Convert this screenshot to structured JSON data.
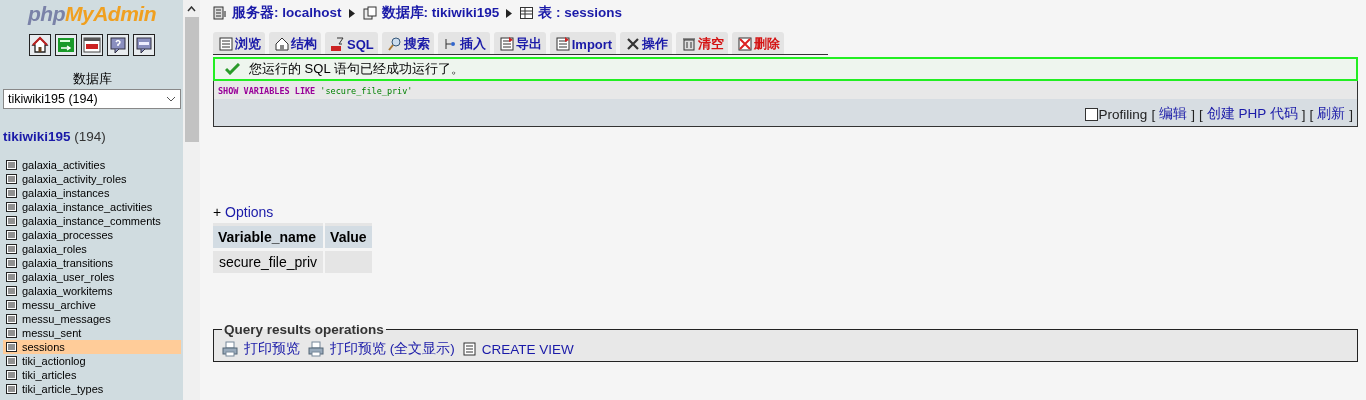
{
  "sidebar": {
    "logo": {
      "php": "php",
      "rest": "MyAdmin"
    },
    "icon_buttons": [
      {
        "kind": "home"
      },
      {
        "kind": "exit"
      },
      {
        "kind": "sql"
      },
      {
        "kind": "help"
      },
      {
        "kind": "docs"
      }
    ],
    "database_label": "数据库",
    "database_select": {
      "value": "tikiwiki195 (194)"
    },
    "db_title": {
      "name": "tikiwiki195",
      "count": "(194)"
    },
    "tables": [
      {
        "name": "galaxia_activities",
        "selected": false
      },
      {
        "name": "galaxia_activity_roles",
        "selected": false
      },
      {
        "name": "galaxia_instances",
        "selected": false
      },
      {
        "name": "galaxia_instance_activities",
        "selected": false
      },
      {
        "name": "galaxia_instance_comments",
        "selected": false
      },
      {
        "name": "galaxia_processes",
        "selected": false
      },
      {
        "name": "galaxia_roles",
        "selected": false
      },
      {
        "name": "galaxia_transitions",
        "selected": false
      },
      {
        "name": "galaxia_user_roles",
        "selected": false
      },
      {
        "name": "galaxia_workitems",
        "selected": false
      },
      {
        "name": "messu_archive",
        "selected": false
      },
      {
        "name": "messu_messages",
        "selected": false
      },
      {
        "name": "messu_sent",
        "selected": false
      },
      {
        "name": "sessions",
        "selected": true
      },
      {
        "name": "tiki_actionlog",
        "selected": false
      },
      {
        "name": "tiki_articles",
        "selected": false
      },
      {
        "name": "tiki_article_types",
        "selected": false
      }
    ]
  },
  "breadcrumb": [
    {
      "kind": "server",
      "label": "服务器: localhost"
    },
    {
      "kind": "database",
      "label": "数据库: tikiwiki195"
    },
    {
      "kind": "table",
      "label": "表 : sessions"
    }
  ],
  "tabs": [
    {
      "label": "浏览",
      "kind": "browse"
    },
    {
      "label": "结构",
      "kind": "structure"
    },
    {
      "label": "SQL",
      "kind": "sql"
    },
    {
      "label": "搜索",
      "kind": "search"
    },
    {
      "label": "插入",
      "kind": "insert"
    },
    {
      "label": "导出",
      "kind": "export"
    },
    {
      "label": "Import",
      "kind": "import"
    },
    {
      "label": "操作",
      "kind": "operations"
    },
    {
      "label": "清空",
      "kind": "empty"
    },
    {
      "label": "删除",
      "kind": "drop"
    }
  ],
  "success_message": "您运行的 SQL 语句已经成功运行了。",
  "query": {
    "keywords": "SHOW VARIABLES LIKE",
    "literal": "'secure_file_priv'"
  },
  "query_actions": {
    "profiling": {
      "label": "Profiling",
      "checked": false
    },
    "links": [
      {
        "open": "[",
        "label": "编辑",
        "close": "]"
      },
      {
        "open": "[",
        "label": "创建 PHP 代码",
        "close": "]"
      },
      {
        "open": "[",
        "label": "刷新",
        "close": "]"
      }
    ]
  },
  "options_toggle": {
    "sign": "+",
    "label": "Options"
  },
  "results": {
    "columns": [
      "Variable_name",
      "Value"
    ],
    "rows": [
      [
        "secure_file_priv",
        ""
      ]
    ]
  },
  "operations": {
    "legend": "Query results operations",
    "links": [
      {
        "kind": "print",
        "label": "打印预览"
      },
      {
        "kind": "print",
        "label": "打印预览 (全文显示)"
      },
      {
        "kind": "view",
        "label": "CREATE VIEW"
      }
    ]
  }
}
